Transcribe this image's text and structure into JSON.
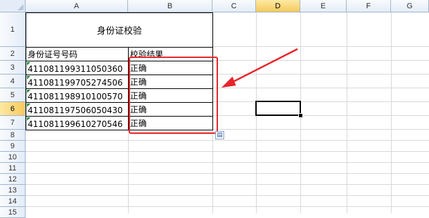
{
  "columns": [
    "A",
    "B",
    "C",
    "D",
    "E",
    "F",
    "G"
  ],
  "selected_column": "D",
  "rows": [
    "1",
    "2",
    "3",
    "4",
    "5",
    "6",
    "7",
    "8",
    "9",
    "10",
    "11",
    "12",
    "13",
    "14",
    "15"
  ],
  "selected_row": "6",
  "sheet": {
    "title": "身份证校验",
    "header_id": "身份证号号码",
    "header_result": "校验结果",
    "records": [
      {
        "id": "411081199311050360",
        "result": "正确"
      },
      {
        "id": "411081199705274506",
        "result": "正确"
      },
      {
        "id": "411081198910100570",
        "result": "正确"
      },
      {
        "id": "411081197506050430",
        "result": "正确"
      },
      {
        "id": "411081199610270546",
        "result": "正确"
      }
    ]
  },
  "colors": {
    "annotation": "#e8242a",
    "header_selected": "#f7c95c",
    "error_indicator": "#1d8c3c"
  },
  "icons": {
    "paste_options": "paste-options-icon",
    "error_indicator": "green-triangle-icon"
  }
}
